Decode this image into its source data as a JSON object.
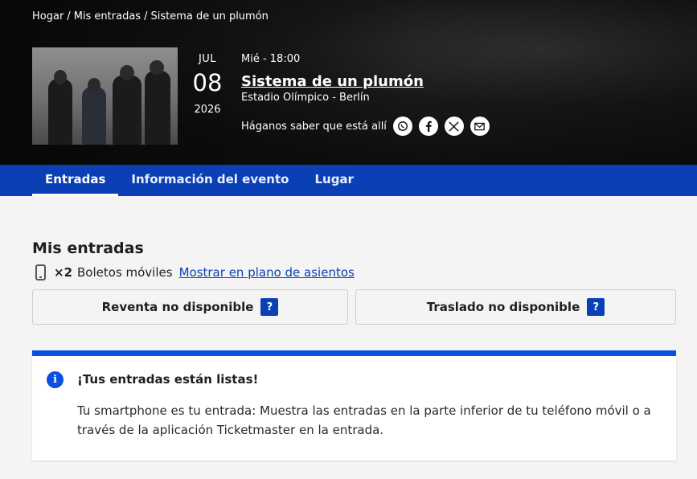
{
  "breadcrumb": {
    "items": [
      "Hogar",
      "Mis entradas",
      "Sistema de un plumón"
    ],
    "separator": "/"
  },
  "event": {
    "month": "JUL",
    "day": "08",
    "year": "2026",
    "time": "Mié - 18:00",
    "title": "Sistema de un plumón",
    "venue": "Estadio Olímpico - Berlín"
  },
  "share": {
    "label": "Háganos saber que está allí",
    "icons": [
      "whatsapp-icon",
      "facebook-icon",
      "x-icon",
      "email-icon"
    ]
  },
  "tabs": [
    {
      "label": "Entradas",
      "active": true
    },
    {
      "label": "Información del evento",
      "active": false
    },
    {
      "label": "Lugar",
      "active": false
    }
  ],
  "tickets": {
    "heading": "Mis entradas",
    "count": "×2",
    "type": "Boletos móviles",
    "seat_link": "Mostrar en plano de asientos",
    "resale_label": "Reventa no disponible",
    "transfer_label": "Traslado no disponible",
    "help_badge": "?"
  },
  "notice": {
    "icon": "i",
    "title": "¡Tus entradas están listas!",
    "body": "Tu smartphone es tu entrada: Muestra las entradas en la parte inferior de tu teléfono móvil o a través de la aplicación Ticketmaster en la entrada."
  },
  "colors": {
    "brand_blue": "#0a3fb6",
    "notice_blue": "#0a4fe0",
    "link_blue": "#0a3fb6"
  }
}
